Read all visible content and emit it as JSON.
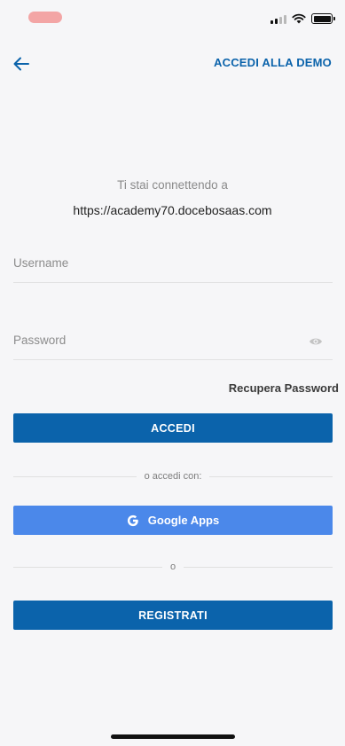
{
  "status_bar": {
    "pill_color": "#f3a5a5"
  },
  "header": {
    "back_icon": "arrow-left-icon",
    "demo_link": "ACCEDI ALLA DEMO"
  },
  "connection": {
    "label": "Ti stai connettendo a",
    "url": "https://academy70.docebosaas.com"
  },
  "form": {
    "username_placeholder": "Username",
    "username_value": "",
    "password_placeholder": "Password",
    "password_value": "",
    "password_toggle_icon": "eye-icon",
    "recover_link": "Recupera Password",
    "login_button": "ACCEDI"
  },
  "social": {
    "divider_text": "o accedi con:",
    "google_button": "Google Apps",
    "google_icon": "google-g-icon"
  },
  "register": {
    "divider_text": "o",
    "register_button": "REGISTRATI"
  },
  "colors": {
    "brand_blue": "#0b63ab",
    "google_blue": "#4b88ea",
    "background": "#f6f6f8"
  }
}
